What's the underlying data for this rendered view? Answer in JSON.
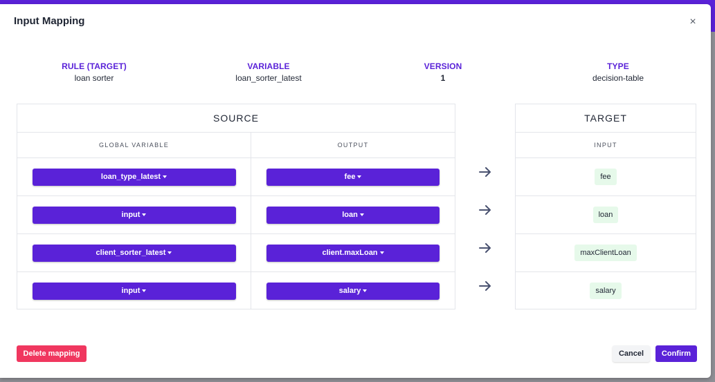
{
  "modal": {
    "title": "Input Mapping",
    "close_label": "×"
  },
  "meta": [
    {
      "label": "RULE (TARGET)",
      "value": "loan sorter"
    },
    {
      "label": "VARIABLE",
      "value": "loan_sorter_latest"
    },
    {
      "label": "VERSION",
      "value": "1"
    },
    {
      "label": "TYPE",
      "value": "decision-table"
    }
  ],
  "source": {
    "title": "SOURCE",
    "col_global": "GLOBAL VARIABLE",
    "col_output": "OUTPUT",
    "rows": [
      {
        "global": "loan_type_latest",
        "output": "fee"
      },
      {
        "global": "input",
        "output": "loan"
      },
      {
        "global": "client_sorter_latest",
        "output": "client.maxLoan"
      },
      {
        "global": "input",
        "output": "salary"
      }
    ]
  },
  "target": {
    "title": "TARGET",
    "col_input": "INPUT",
    "rows": [
      "fee",
      "loan",
      "maxClientLoan",
      "salary"
    ]
  },
  "footer": {
    "delete_label": "Delete mapping",
    "cancel_label": "Cancel",
    "confirm_label": "Confirm"
  },
  "colors": {
    "accent": "#5a22d8",
    "danger": "#f0375f",
    "chip": "#e6f9ea"
  }
}
